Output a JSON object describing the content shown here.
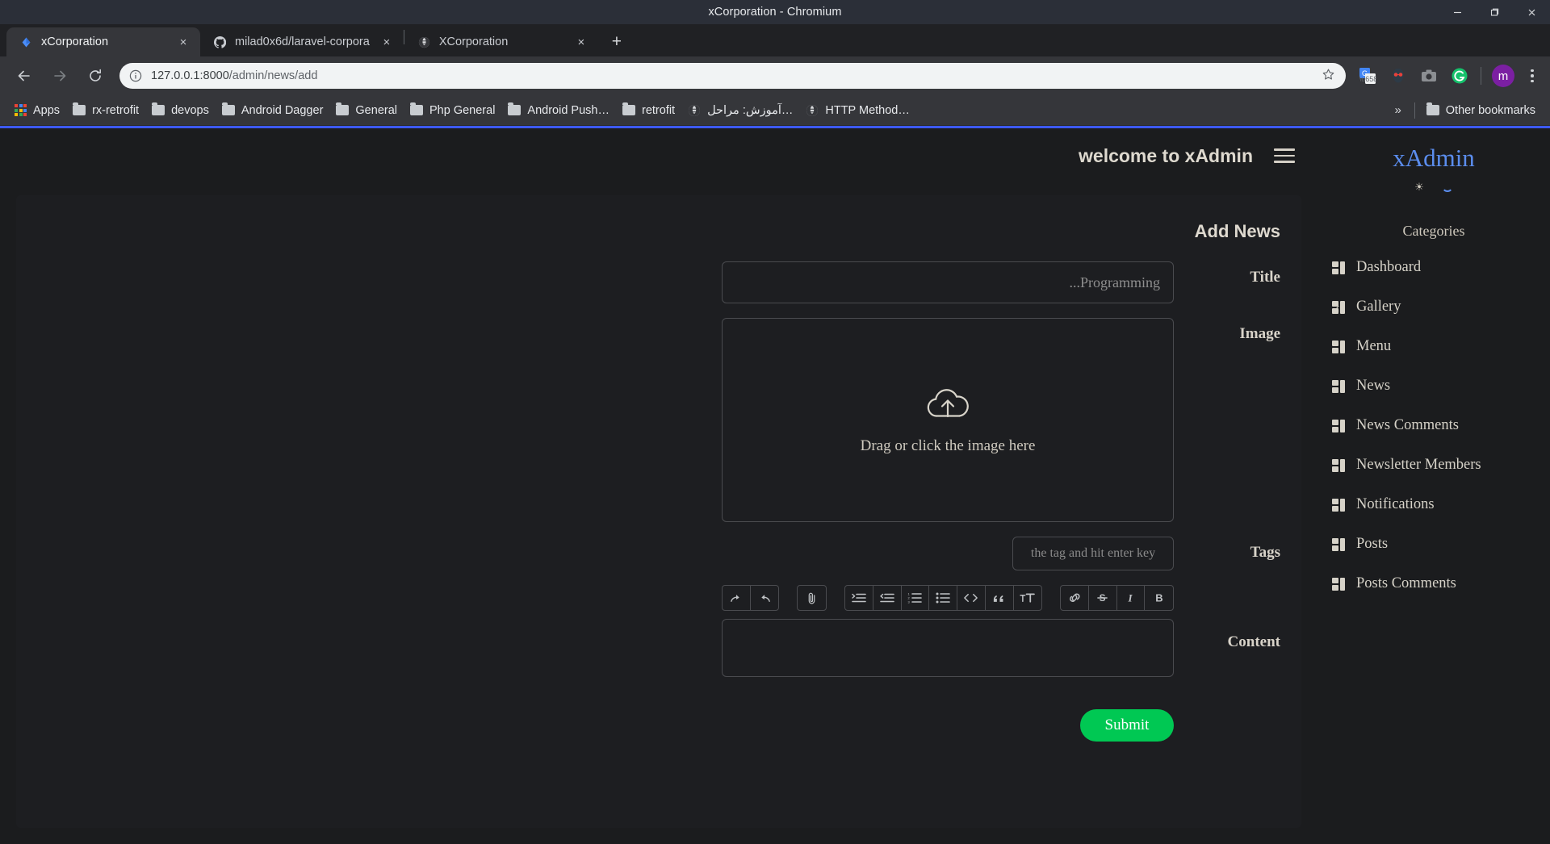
{
  "window": {
    "title": "xCorporation - Chromium",
    "controls": {
      "minimize": "minimize-icon",
      "maximize": "maximize-icon",
      "close": "close-icon"
    }
  },
  "tabs": [
    {
      "title": "xCorporation",
      "favicon": "diamond-icon",
      "active": true,
      "close_label": "×"
    },
    {
      "title": "milad0x6d/laravel-corpora",
      "favicon": "github-icon",
      "active": false,
      "close_label": "×"
    },
    {
      "title": "XCorporation",
      "favicon": "globe-icon",
      "active": false,
      "close_label": "×"
    }
  ],
  "new_tab_label": "+",
  "toolbar": {
    "back": "back-arrow-icon",
    "forward": "forward-arrow-icon",
    "reload": "reload-icon",
    "url_host": "127.0.0.1:8000",
    "url_path": "/admin/news/add",
    "bookmark_star": "star-icon",
    "extensions": [
      "google-translate-icon",
      "dark-reader-icon",
      "screenshot-camera-icon",
      "grammarly-icon"
    ],
    "profile_initial": "m",
    "menu": "three-dots-icon"
  },
  "bookmarks": {
    "apps_label": "Apps",
    "items": [
      {
        "label": "rx-retrofit",
        "icon": "folder-icon"
      },
      {
        "label": "devops",
        "icon": "folder-icon"
      },
      {
        "label": "Android Dagger",
        "icon": "folder-icon"
      },
      {
        "label": "General",
        "icon": "folder-icon"
      },
      {
        "label": "Php General",
        "icon": "folder-icon"
      },
      {
        "label": "Android Push…",
        "icon": "folder-icon"
      },
      {
        "label": "retrofit",
        "icon": "folder-icon"
      },
      {
        "label": "آموزش: مراحل…",
        "icon": "globe-icon"
      },
      {
        "label": "HTTP Method…",
        "icon": "globe-icon"
      }
    ],
    "overflow_label": "»",
    "other_bookmarks_label": "Other bookmarks"
  },
  "app": {
    "accent_color": "#3d5afe",
    "brand": "xAdmin",
    "topbar": {
      "welcome": "welcome to xAdmin",
      "menu_icon": "hamburger-icon"
    },
    "sidebar": {
      "section_label": "Categories",
      "items": [
        {
          "label": "Dashboard",
          "icon": "grid-icon",
          "expandable": false
        },
        {
          "label": "Gallery",
          "icon": "grid-icon",
          "expandable": true,
          "chevron": "›"
        },
        {
          "label": "Menu",
          "icon": "grid-icon",
          "expandable": false
        },
        {
          "label": "News",
          "icon": "grid-icon",
          "expandable": false
        },
        {
          "label": "News Comments",
          "icon": "grid-icon",
          "expandable": false
        },
        {
          "label": "Newsletter Members",
          "icon": "grid-icon",
          "expandable": false
        },
        {
          "label": "Notifications",
          "icon": "grid-icon",
          "expandable": false
        },
        {
          "label": "Posts",
          "icon": "grid-icon",
          "expandable": false
        },
        {
          "label": "Posts Comments",
          "icon": "grid-icon",
          "expandable": false
        }
      ]
    },
    "form": {
      "card_title": "Add News",
      "title_label": "Title",
      "title_placeholder": "Programming...",
      "title_value": "",
      "image_label": "Image",
      "dropzone_text": "Drag or click the image here",
      "dropzone_icon": "cloud-upload-icon",
      "tags_label": "Tags",
      "tags_placeholder": "the tag and hit enter key",
      "tags_value": "",
      "content_label": "Content",
      "content_value": "",
      "submit_label": "Submit",
      "submit_color": "#00c853",
      "editor_tools": [
        {
          "name": "redo-icon",
          "glyph": "↷"
        },
        {
          "name": "undo-icon",
          "glyph": "↶"
        },
        {
          "name": "attachment-icon",
          "glyph": "📎"
        },
        {
          "name": "indent-icon",
          "glyph": "indent"
        },
        {
          "name": "outdent-icon",
          "glyph": "outdent"
        },
        {
          "name": "ordered-list-icon",
          "glyph": "ol"
        },
        {
          "name": "unordered-list-icon",
          "glyph": "ul"
        },
        {
          "name": "code-icon",
          "glyph": "<>"
        },
        {
          "name": "quote-icon",
          "glyph": "”"
        },
        {
          "name": "text-size-icon",
          "glyph": "tT"
        },
        {
          "name": "link-icon",
          "glyph": "link"
        },
        {
          "name": "strikethrough-icon",
          "glyph": "S"
        },
        {
          "name": "italic-icon",
          "glyph": "I"
        },
        {
          "name": "bold-icon",
          "glyph": "B"
        }
      ]
    }
  }
}
